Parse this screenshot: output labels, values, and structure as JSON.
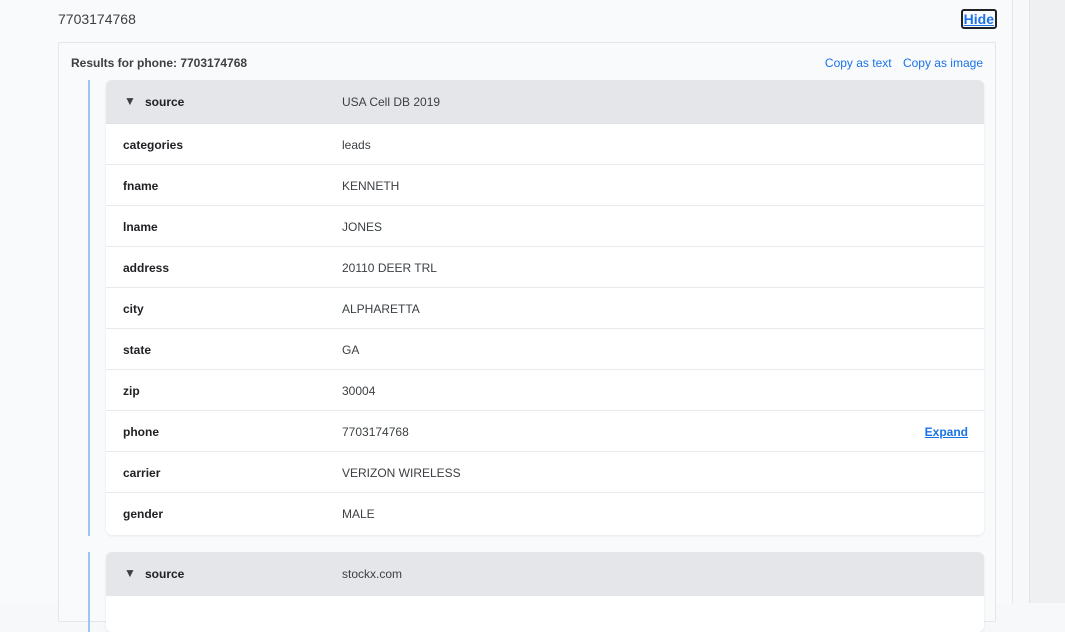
{
  "query": {
    "title": "7703174768",
    "hide_label": "Hide"
  },
  "results": {
    "title": "Results for phone: 7703174768",
    "copy_text_label": "Copy as text",
    "copy_image_label": "Copy as image"
  },
  "records": [
    {
      "source_key": "source",
      "source_value": "USA Cell DB 2019",
      "toggle_glyph": "▼",
      "fields": [
        {
          "key": "categories",
          "value": "leads"
        },
        {
          "key": "fname",
          "value": "KENNETH"
        },
        {
          "key": "lname",
          "value": "JONES"
        },
        {
          "key": "address",
          "value": "20110 DEER TRL"
        },
        {
          "key": "city",
          "value": "ALPHARETTA"
        },
        {
          "key": "state",
          "value": "GA"
        },
        {
          "key": "zip",
          "value": "30004"
        },
        {
          "key": "phone",
          "value": "7703174768",
          "action": "Expand"
        },
        {
          "key": "carrier",
          "value": "VERIZON WIRELESS"
        },
        {
          "key": "gender",
          "value": "MALE"
        }
      ]
    },
    {
      "source_key": "source",
      "source_value": "stockx.com",
      "toggle_glyph": "▼",
      "fields": []
    }
  ],
  "colors": {
    "accent": "#1a73e8",
    "record_border": "#9ec5ef",
    "source_row_bg": "#e4e6ea"
  }
}
